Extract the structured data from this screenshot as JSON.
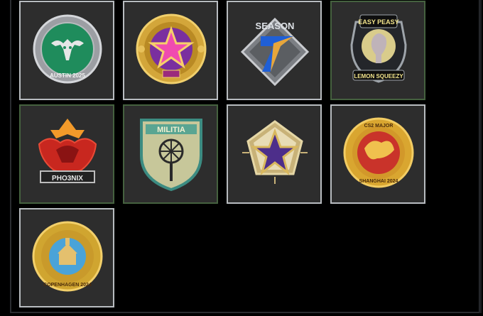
{
  "inventory": {
    "tiles": [
      {
        "name": "austin-2025-medal",
        "border": "#b8bcc0",
        "ring_top_text": "",
        "ring_bottom_text": "AUSTIN 2025"
      },
      {
        "name": "purple-star-coin",
        "border": "#b8bcc0"
      },
      {
        "name": "season-7-medal",
        "border": "#b8bcc0",
        "label": "SEASON"
      },
      {
        "name": "easy-peasy-lemon-squeezy-pin",
        "border": "#45613f",
        "top_text": "EASY PEASY",
        "bottom_text": "LEMON SQUEEZY"
      },
      {
        "name": "phoenix-pin",
        "border": "#45613f",
        "label": "PHO3NIX"
      },
      {
        "name": "militia-pin",
        "border": "#45613f",
        "label": "MILITIA"
      },
      {
        "name": "service-medal-star",
        "border": "#b8bcc0"
      },
      {
        "name": "shanghai-2024-coin",
        "border": "#b8bcc0",
        "ring_top_text": "CS2 MAJOR",
        "ring_bottom_text": "SHANGHAI 2024"
      },
      {
        "name": "copenhagen-2024-coin",
        "border": "#b8bcc0",
        "ring_bottom_text": "COPENHAGEN 2024"
      }
    ]
  }
}
